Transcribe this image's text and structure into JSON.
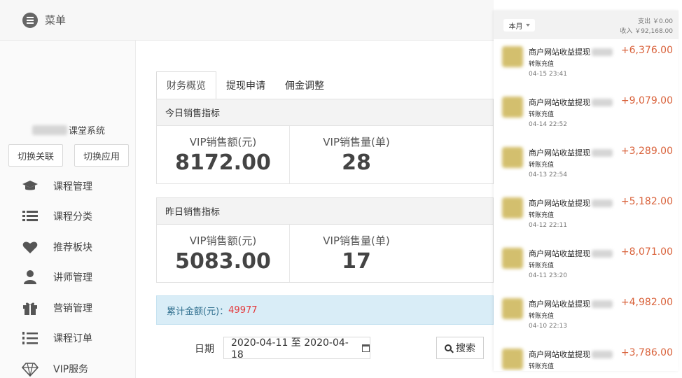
{
  "topbar": {
    "menu_label": "菜单"
  },
  "sidebar": {
    "system_name_suffix": "课堂系统",
    "switch_left": "切换关联",
    "switch_right": "切换应用",
    "items": [
      {
        "label": "课程管理",
        "icon": "graduation-cap-icon"
      },
      {
        "label": "课程分类",
        "icon": "list-icon"
      },
      {
        "label": "推荐板块",
        "icon": "heart-icon"
      },
      {
        "label": "讲师管理",
        "icon": "teacher-icon"
      },
      {
        "label": "营销管理",
        "icon": "gift-icon"
      },
      {
        "label": "课程订单",
        "icon": "ordered-list-icon"
      },
      {
        "label": "VIP服务",
        "icon": "diamond-icon"
      }
    ]
  },
  "main": {
    "tabs": [
      "财务概览",
      "提现申请",
      "佣金调整"
    ],
    "today": {
      "title": "今日销售指标",
      "sales_label": "VIP销售额(元)",
      "sales_value": "8172.00",
      "count_label": "VIP销售量(单)",
      "count_value": "28"
    },
    "yesterday": {
      "title": "昨日销售指标",
      "sales_label": "VIP销售额(元)",
      "sales_value": "5083.00",
      "count_label": "VIP销售量(单)",
      "count_value": "17"
    },
    "total_label": "累计金额(元)：",
    "total_value": "49977",
    "date_label": "日期",
    "date_range": "2020-04-11 至 2020-04-18",
    "search_label": "搜索"
  },
  "phone": {
    "month": "本月",
    "expense": "支出 ￥0.00",
    "income": "收入 ￥92,168.00",
    "transactions": [
      {
        "title": "商户网站收益提现",
        "sub": "转账充值",
        "time": "04-15  23:41",
        "amount": "+6,376.00"
      },
      {
        "title": "商户网站收益提现",
        "sub": "转账充值",
        "time": "04-14  22:52",
        "amount": "+9,079.00"
      },
      {
        "title": "商户网站收益提现",
        "sub": "转账充值",
        "time": "04-13  22:54",
        "amount": "+3,289.00"
      },
      {
        "title": "商户网站收益提现",
        "sub": "转账充值",
        "time": "04-12  22:11",
        "amount": "+5,182.00"
      },
      {
        "title": "商户网站收益提现",
        "sub": "转账充值",
        "time": "04-11  23:20",
        "amount": "+8,071.00"
      },
      {
        "title": "商户网站收益提现",
        "sub": "转账充值",
        "time": "04-10  22:13",
        "amount": "+4,982.00"
      },
      {
        "title": "商户网站收益提现",
        "sub": "转账充值",
        "time": "",
        "amount": "+3,786.00"
      }
    ]
  },
  "colors": {
    "amount": "#d9623b",
    "total": "#e4393c",
    "info_bg": "#d9edf7"
  }
}
